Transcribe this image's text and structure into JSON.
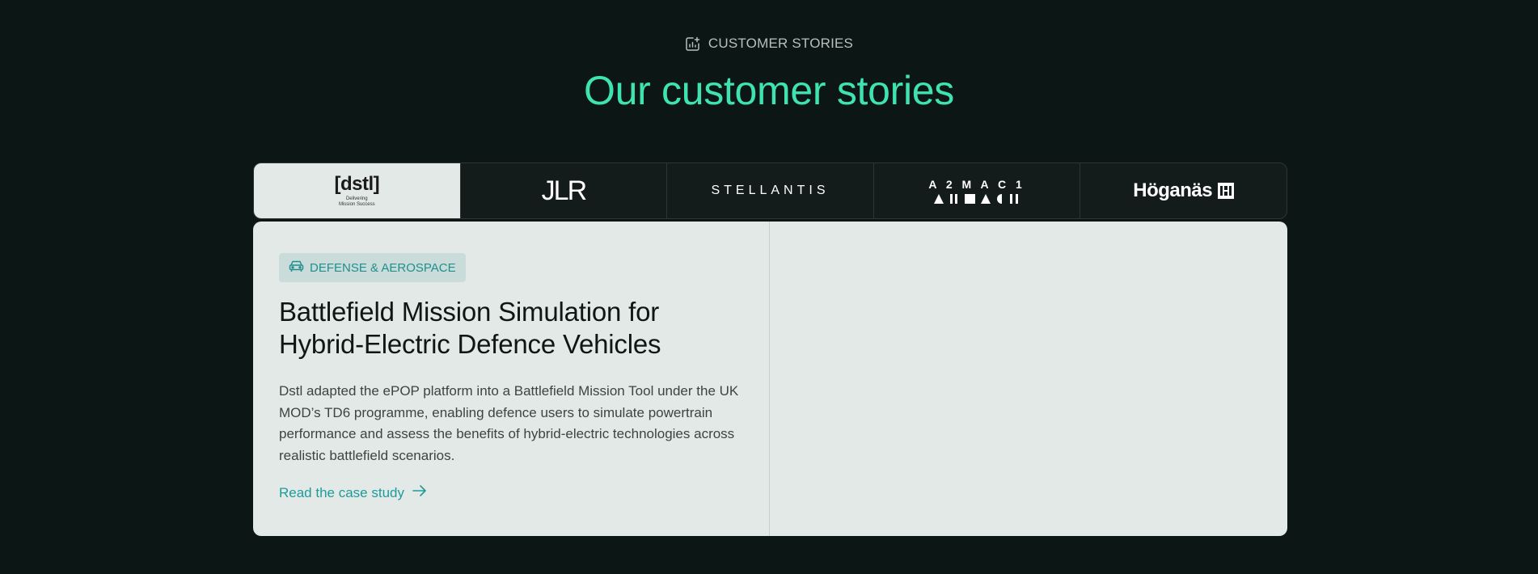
{
  "eyebrow": {
    "icon": "chart-sparkle-icon",
    "label": "CUSTOMER STORIES"
  },
  "heading": "Our customer stories",
  "tabs": [
    {
      "name": "dstl",
      "logo_text": "[dstl]",
      "logo_sub1": "Delivering",
      "logo_sub2": "Mission Success",
      "active": true
    },
    {
      "name": "jlr",
      "logo_text": "JLR",
      "active": false
    },
    {
      "name": "stellantis",
      "logo_text": "STELLANTIS",
      "active": false
    },
    {
      "name": "a2mac1",
      "logo_text": "A 2 M A C 1",
      "active": false
    },
    {
      "name": "hoganas",
      "logo_text": "Höganäs",
      "active": false
    }
  ],
  "story": {
    "category_icon": "car-icon",
    "category": "DEFENSE & AEROSPACE",
    "title_line1": "Battlefield Mission Simulation for",
    "title_line2": "Hybrid-Electric Defence Vehicles",
    "description": "Dstl adapted the ePOP platform into a Battlefield Mission Tool under the UK MOD’s TD6 programme, enabling defence users to simulate powertrain performance and assess the benefits of hybrid-electric technologies across realistic battlefield scenarios.",
    "link_label": "Read the case study",
    "link_icon": "arrow-right-icon"
  },
  "colors": {
    "background": "#0c1614",
    "accent": "#3fe3b0",
    "card": "#e2e9e6",
    "link": "#1f9b9b"
  }
}
